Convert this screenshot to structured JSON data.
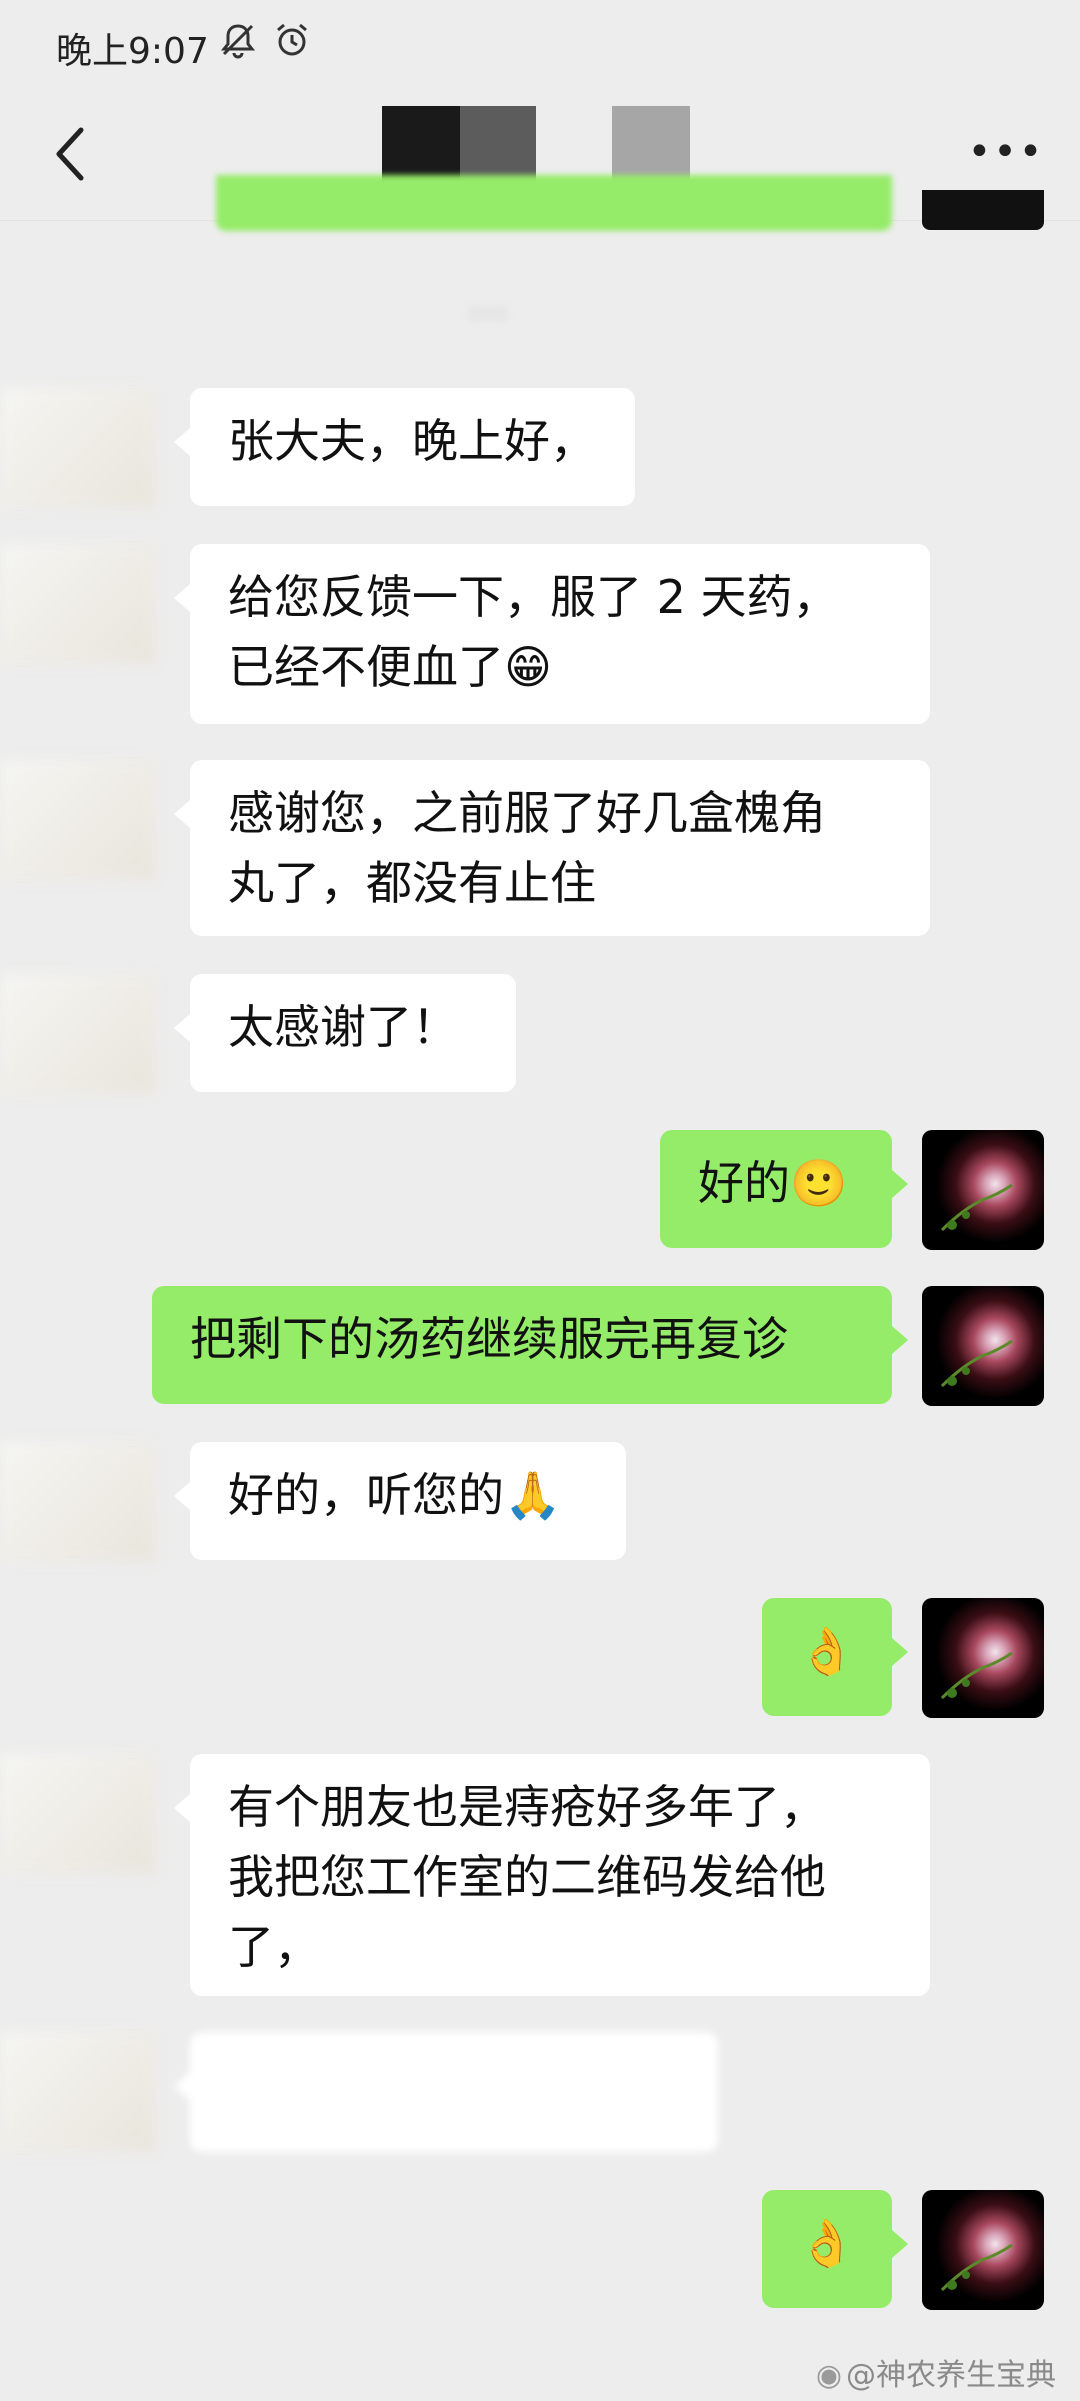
{
  "status_bar": {
    "time": "晚上9:07",
    "silent_icon": "bell-off-icon",
    "alarm_icon": "alarm-clock-icon"
  },
  "nav": {
    "back_icon": "chevron-left-icon",
    "more_label": "•••"
  },
  "messages": [
    {
      "side": "in",
      "text": "张大夫，晚上好，"
    },
    {
      "side": "in",
      "text": "给您反馈一下，服了 2 天药，\n已经不便血了😁"
    },
    {
      "side": "in",
      "text": "感谢您，之前服了好几盒槐角\n丸了，都没有止住"
    },
    {
      "side": "in",
      "text": "太感谢了！"
    },
    {
      "side": "out",
      "text": "好的🙂"
    },
    {
      "side": "out",
      "text": "把剩下的汤药继续服完再复诊"
    },
    {
      "side": "in",
      "text": "好的，听您的🙏"
    },
    {
      "side": "out",
      "text": "👌"
    },
    {
      "side": "in",
      "text": "有个朋友也是痔疮好多年了，\n我把您工作室的二维码发给他\n了，"
    },
    {
      "side": "in",
      "text": ""
    },
    {
      "side": "out",
      "text": "👌"
    }
  ],
  "watermark": "@神农养生宝典",
  "colors": {
    "background": "#ededed",
    "incoming_bubble": "#ffffff",
    "outgoing_bubble": "#95ec69"
  }
}
